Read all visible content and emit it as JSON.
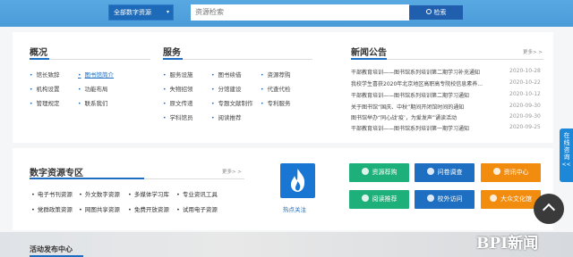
{
  "search": {
    "category_label": "全部数字资源",
    "placeholder": "资源检索",
    "button_label": "检索"
  },
  "overview": {
    "title": "概况",
    "links": [
      "馆长致辞",
      "图书馆简介",
      "机构设置",
      "功能布局",
      "管理规定",
      "联系我们"
    ]
  },
  "services": {
    "title": "服务",
    "links": [
      "服务设施",
      "图书续借",
      "资源荐购",
      "失物招领",
      "分馆建设",
      "代查代检",
      "原文传递",
      "专题文献制作",
      "专利服务",
      "学科馆员",
      "阅读推荐"
    ]
  },
  "news": {
    "title": "新闻公告",
    "more_label": "更多> >",
    "items": [
      {
        "title": "干部教育培训——图书馆系列培训第二期学习补充通知",
        "date": "2020-10-28"
      },
      {
        "title": "我校学生喜获2020年北京地区高职高专院校信息素养...",
        "date": "2020-10-22"
      },
      {
        "title": "干部教育培训——图书馆系列培训第二期学习通知",
        "date": "2020-10-12"
      },
      {
        "title": "关于图书馆“国庆、中秋”期间开闭馆时间的通知",
        "date": "2020-09-30"
      },
      {
        "title": "图书馆举办“同心战‘疫’，为爱发声”诵读活动",
        "date": "2020-09-30"
      },
      {
        "title": "干部教育培训——图书馆系列培训第一期学习通知",
        "date": "2020-09-25"
      }
    ]
  },
  "digital": {
    "title": "数字资源专区",
    "more_label": "更多> >",
    "links": [
      "电子书刊资源",
      "外文数字资源",
      "多媒体学习库",
      "专业资讯工具",
      "党群政策资源",
      "网图共享资源",
      "免费开放资源",
      "试用电子资源"
    ]
  },
  "hot": {
    "label": "热点关注",
    "icon": "flame-icon"
  },
  "tiles": [
    {
      "label": "资源荐购",
      "color": "#1db07a"
    },
    {
      "label": "问卷调查",
      "color": "#1e6fc1"
    },
    {
      "label": "资讯中心",
      "color": "#f28c0f"
    },
    {
      "label": "阅读推荐",
      "color": "#1db07a"
    },
    {
      "label": "校外访问",
      "color": "#1e6fc1"
    },
    {
      "label": "大众文化馆",
      "color": "#f28c0f"
    }
  ],
  "events": {
    "title": "活动发布中心"
  },
  "side": {
    "consult_label": "在线咨询",
    "collapse_label": "<<"
  },
  "watermark": "BPI新闻"
}
